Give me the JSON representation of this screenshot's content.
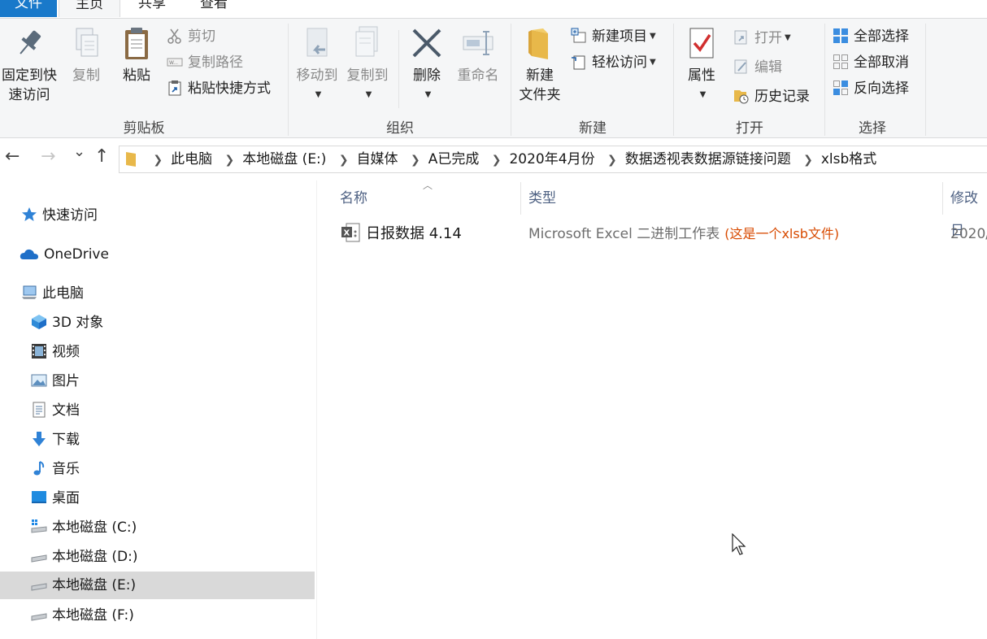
{
  "tabs": {
    "file": "文件",
    "home": "主页",
    "share": "共享",
    "view": "查看"
  },
  "ribbon": {
    "clipboard": {
      "label": "剪贴板",
      "pin_line1": "固定到快",
      "pin_line2": "速访问",
      "copy": "复制",
      "paste": "粘贴",
      "cut": "剪切",
      "copy_path": "复制路径",
      "paste_shortcut": "粘贴快捷方式"
    },
    "organize": {
      "label": "组织",
      "move_to": "移动到",
      "copy_to": "复制到",
      "delete": "删除",
      "rename": "重命名"
    },
    "new": {
      "label": "新建",
      "new_folder_line1": "新建",
      "new_folder_line2": "文件夹",
      "new_item": "新建项目",
      "easy_access": "轻松访问"
    },
    "open": {
      "label": "打开",
      "properties": "属性",
      "open": "打开",
      "edit": "编辑",
      "history": "历史记录"
    },
    "select": {
      "label": "选择",
      "select_all": "全部选择",
      "select_none": "全部取消",
      "invert": "反向选择"
    }
  },
  "nav": {
    "back": "←",
    "forward": "→",
    "recent": "⌄",
    "up": "↑"
  },
  "breadcrumb": [
    "此电脑",
    "本地磁盘 (E:)",
    "自媒体",
    "A已完成",
    "2020年4月份",
    "数据透视表数据源链接问题",
    "xlsb格式"
  ],
  "sidebar": {
    "quick_access": "快速访问",
    "onedrive": "OneDrive",
    "this_pc": "此电脑",
    "items": [
      {
        "label": "3D 对象",
        "icon": "3d-objects-icon"
      },
      {
        "label": "视频",
        "icon": "video-icon"
      },
      {
        "label": "图片",
        "icon": "pictures-icon"
      },
      {
        "label": "文档",
        "icon": "documents-icon"
      },
      {
        "label": "下载",
        "icon": "downloads-icon"
      },
      {
        "label": "音乐",
        "icon": "music-icon"
      },
      {
        "label": "桌面",
        "icon": "desktop-icon"
      },
      {
        "label": "本地磁盘 (C:)",
        "icon": "drive-icon"
      },
      {
        "label": "本地磁盘 (D:)",
        "icon": "drive-icon"
      },
      {
        "label": "本地磁盘 (E:)",
        "icon": "drive-icon",
        "selected": true
      },
      {
        "label": "本地磁盘 (F:)",
        "icon": "drive-icon"
      }
    ]
  },
  "columns": {
    "name": "名称",
    "type": "类型",
    "modified": "修改日"
  },
  "files": [
    {
      "name": "日报数据 4.14",
      "type": "Microsoft Excel 二进制工作表",
      "annotation": "(这是一个xlsb文件)",
      "modified": "2020/"
    }
  ],
  "colors": {
    "accent": "#1979ca",
    "annotation": "#d84a00",
    "selected": "#d9d9d9"
  }
}
